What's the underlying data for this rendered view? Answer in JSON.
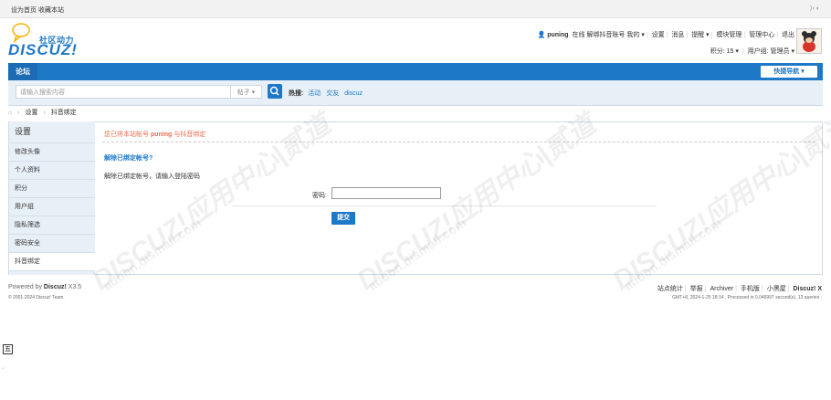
{
  "topbar": {
    "set_home": "设为首页",
    "favorite": "收藏本站",
    "right_icons": "⟩‹ ◐"
  },
  "logo": {
    "tagline": "社区动力",
    "wordmark": "DISCUZ!"
  },
  "user": {
    "name": "puning",
    "status": "在线",
    "menu": [
      "解绑抖音账号",
      "我的 ▾",
      "设置",
      "消息",
      "提醒 ▾",
      "模块管理",
      "管理中心",
      "退出"
    ],
    "points": "积分: 15 ▾",
    "usergroup": "用户组: 管理员 ▾"
  },
  "nav": {
    "forum": "论坛",
    "quick_nav": "快捷导航 ▾"
  },
  "search": {
    "placeholder": "请输入搜索内容",
    "type": "帖子 ▾",
    "hot_label": "热搜:",
    "hot_tags": [
      "活动",
      "交友",
      "discuz"
    ]
  },
  "breadcrumb": [
    "设置",
    "抖音绑定"
  ],
  "sidebar": {
    "title": "设置",
    "items": [
      "修改头像",
      "个人资料",
      "积分",
      "用户组",
      "隐私筛选",
      "密码安全",
      "抖音绑定"
    ],
    "active_index": 6
  },
  "main": {
    "notice_prefix": "您已将本站帐号",
    "notice_user": "puning",
    "notice_suffix": "与抖音绑定",
    "unbind_title": "解除已绑定帐号?",
    "unbind_desc": "解除已绑定帐号，请输入登陆密码",
    "password_label": "密码:",
    "password_value": "",
    "submit_label": "提交"
  },
  "watermarks": {
    "text": "DISCUZ!应用中心|贰道",
    "url": "addon.dismall.com"
  },
  "footer": {
    "powered_prefix": "Powered by",
    "powered_brand": "Discuz!",
    "powered_version": "X3.5",
    "copyright": "© 2001-2024 Discuz! Team.",
    "links": [
      "站点统计",
      "举报",
      "Archiver",
      "手机版",
      "小黑屋"
    ],
    "brand": "Discuz! X",
    "stats": "GMT+8, 2024-1-25 18:14 , Processed in 0.046997 second(s), 13 queries ."
  },
  "ime": {
    "char": "五",
    "label": "´´"
  },
  "colors": {
    "primary": "#1e78c8",
    "notice": "#f26c4f",
    "sidebar_bg": "#e8f0f7"
  }
}
